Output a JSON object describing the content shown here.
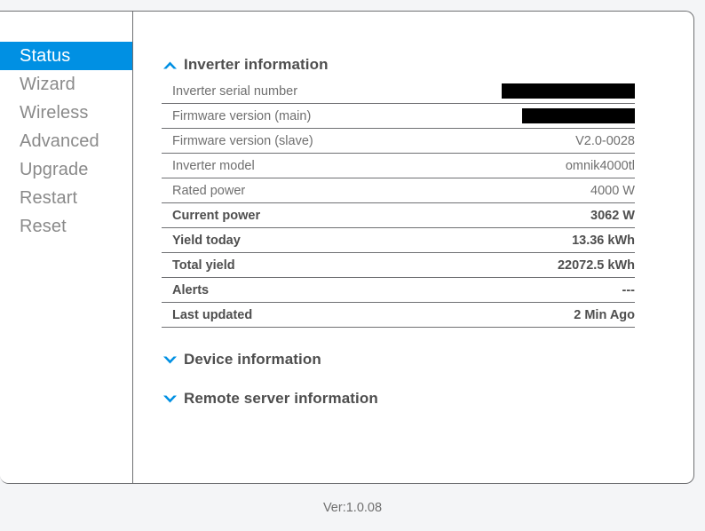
{
  "theme": {
    "accent": "#0090e3",
    "page_background": "#f4f5f7",
    "card_background": "#ffffff",
    "border": "#6f7073",
    "label_text": "#6f6f6f",
    "strong_text": "#4e4e4e",
    "nav_text": "#8a8a8a",
    "redaction": "#000000"
  },
  "sidebar": {
    "items": [
      {
        "label": "Status",
        "icon": "status-icon",
        "active": true
      },
      {
        "label": "Wizard",
        "icon": "wizard-icon",
        "active": false
      },
      {
        "label": "Wireless",
        "icon": "wireless-icon",
        "active": false
      },
      {
        "label": "Advanced",
        "icon": "advanced-icon",
        "active": false
      },
      {
        "label": "Upgrade",
        "icon": "upgrade-icon",
        "active": false
      },
      {
        "label": "Restart",
        "icon": "restart-icon",
        "active": false
      },
      {
        "label": "Reset",
        "icon": "reset-icon",
        "active": false
      }
    ]
  },
  "main": {
    "sections": [
      {
        "title": "Inverter information",
        "expanded": true,
        "icon": "chevron-up-icon",
        "rows": [
          {
            "label": "Inverter serial number",
            "value": "",
            "redacted": true,
            "strong": false
          },
          {
            "label": "Firmware version (main)",
            "value": "",
            "redacted": true,
            "strong": false
          },
          {
            "label": "Firmware version (slave)",
            "value": "V2.0-0028",
            "redacted": false,
            "strong": false
          },
          {
            "label": "Inverter model",
            "value": "omnik4000tl",
            "redacted": false,
            "strong": false
          },
          {
            "label": "Rated power",
            "value": "4000 W",
            "redacted": false,
            "strong": false
          },
          {
            "label": "Current power",
            "value": "3062 W",
            "redacted": false,
            "strong": true
          },
          {
            "label": "Yield today",
            "value": "13.36 kWh",
            "redacted": false,
            "strong": true
          },
          {
            "label": "Total yield",
            "value": "22072.5 kWh",
            "redacted": false,
            "strong": true
          },
          {
            "label": "Alerts",
            "value": "---",
            "redacted": false,
            "strong": true
          },
          {
            "label": "Last updated",
            "value": "2 Min Ago",
            "redacted": false,
            "strong": true
          }
        ]
      },
      {
        "title": "Device information",
        "expanded": false,
        "icon": "chevron-down-icon",
        "rows": []
      },
      {
        "title": "Remote server information",
        "expanded": false,
        "icon": "chevron-down-icon",
        "rows": []
      }
    ]
  },
  "footer": {
    "version": "Ver:1.0.08"
  }
}
